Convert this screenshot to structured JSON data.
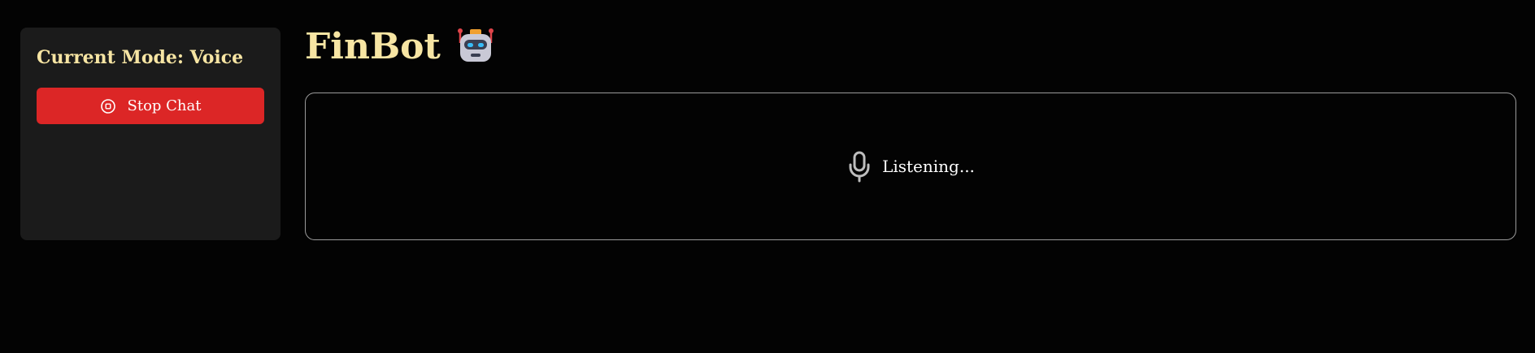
{
  "sidebar": {
    "mode_title": "Current Mode: Voice",
    "stop_button": {
      "label": "Stop Chat",
      "icon": "stop-circle-icon"
    }
  },
  "header": {
    "title": "FinBot",
    "icon": "robot-icon"
  },
  "voice_panel": {
    "icon": "microphone-icon",
    "status_text": "Listening..."
  },
  "colors": {
    "background": "#030303",
    "sidebar_bg": "#1b1b1b",
    "accent_gold": "#f7e5a3",
    "stop_red": "#dc2626",
    "panel_border": "#9a9a9a"
  }
}
